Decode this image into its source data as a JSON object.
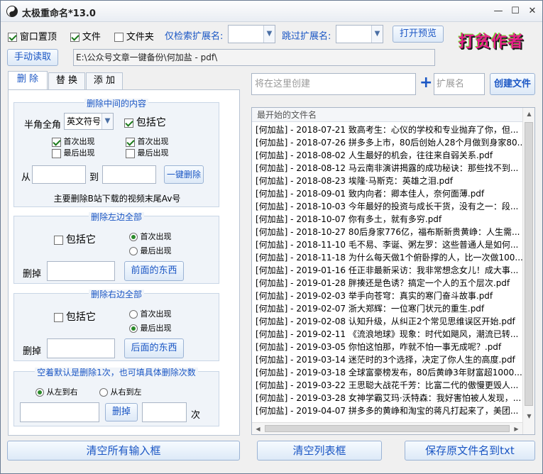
{
  "app": {
    "title": "太极重命名*13.0",
    "window_controls": {
      "minimize": "—",
      "maximize": "☐",
      "close": "✕"
    }
  },
  "top_bar": {
    "stay_on_top": {
      "label": "窗口置顶",
      "checked": true
    },
    "file": {
      "label": "文件",
      "checked": true
    },
    "folder": {
      "label": "文件夹",
      "checked": false
    },
    "only_ext_label": "仅检索扩展名:",
    "only_ext_value": "",
    "skip_ext_label": "跳过扩展名:",
    "skip_ext_value": "",
    "open_preview_button": "打开预览",
    "logo_text": "打贫作者",
    "manual_read_button": "手动读取",
    "path": "E:\\公众号文章一键备份\\何加盐 - pdf\\"
  },
  "tabs": [
    "删 除",
    "替 换",
    "添 加"
  ],
  "delete_middle": {
    "title": "删除中间的内容",
    "width_label": "半角全角",
    "width_value": "英文符号",
    "include_label": "包括它",
    "include_checked": true,
    "left_first": {
      "label": "首次出现",
      "checked": true
    },
    "left_last": {
      "label": "最后出现",
      "checked": false
    },
    "right_first": {
      "label": "首次出现",
      "checked": true
    },
    "right_last": {
      "label": "最后出现",
      "checked": false
    },
    "from_label": "从",
    "from_value": "",
    "to_label": "到",
    "to_value": "",
    "delete_button": "一键删除",
    "hint": "主要删除B站下载的视频末尾Av号"
  },
  "delete_left": {
    "title": "删除左边全部",
    "include_label": "包括它",
    "include_checked": false,
    "first": {
      "label": "首次出现",
      "checked": true
    },
    "last": {
      "label": "最后出现",
      "checked": false
    },
    "remove_label": "删掉",
    "remove_value": "",
    "button": "前面的东西"
  },
  "delete_right": {
    "title": "删除右边全部",
    "include_label": "包括它",
    "include_checked": false,
    "first": {
      "label": "首次出现",
      "checked": false
    },
    "last": {
      "label": "最后出现",
      "checked": true
    },
    "remove_label": "删掉",
    "remove_value": "",
    "button": "后面的东西"
  },
  "delete_count": {
    "title": "空着默认是删除1次，也可填具体删除次数",
    "left_to_right": {
      "label": "从左到右",
      "checked": true
    },
    "right_to_left": {
      "label": "从右到左",
      "checked": false
    },
    "text_value": "",
    "delete_button": "删掉",
    "count_value": "",
    "times_label": "次"
  },
  "create": {
    "placeholder": "将在这里创建",
    "plus": "+",
    "ext_placeholder": "扩展名",
    "button": "创建文件"
  },
  "file_list": {
    "header": "最开始的文件名",
    "rows": [
      "[何加盐] - 2018-07-21 致高考生：心仪的学校和专业抛弃了你，但...",
      "[何加盐] - 2018-07-26 拼多多上市，80后创始人28个月做到身家80...",
      "[何加盐] - 2018-08-02 人生最好的机会，往往来自弱关系.pdf",
      "[何加盐] - 2018-08-12 马云南非演讲揭露的成功秘诀：那些找不到...",
      "[何加盐] - 2018-08-23 埃隆·马斯克：英雄之泪.pdf",
      "[何加盐] - 2018-09-01 致内向者：卿本佳人，奈何面薄.pdf",
      "[何加盐] - 2018-10-03 今年最好的投资与成长干货，没有之一：段...",
      "[何加盐] - 2018-10-07 你有多土，就有多穷.pdf",
      "[何加盐] - 2018-10-27 80后身家776亿，福布斯新贵黄峥：人生需...",
      "[何加盐] - 2018-11-10 毛不易、李诞、粥左罗：这些普通人是如何...",
      "[何加盐] - 2018-11-18 为什么每天做1个俯卧撑的人，比一次做100...",
      "[何加盐] - 2019-01-16 任正非最新采访：我非常想念女儿！成大事...",
      "[何加盐] - 2019-01-28 胖揍还是色诱？搞定一个人的五个层次.pdf",
      "[何加盐] - 2019-02-03 举手向苍穹：真实的寒门奋斗故事.pdf",
      "[何加盐] - 2019-02-07 浙大郑辉：一位寒门状元的重生.pdf",
      "[何加盐] - 2019-02-08 认知升级，从纠正2个常见思维误区开始.pdf",
      "[何加盐] - 2019-02-11 《流浪地球》现象：时代如飓风，潮流已转...",
      "[何加盐] - 2019-03-05 你怕这怕那，咋就不怕一事无成呢？.pdf",
      "[何加盐] - 2019-03-14 迷茫时的3个选择，决定了你人生的高度.pdf",
      "[何加盐] - 2019-03-18 全球富豪榜发布，80后黄峥3年财富超1000...",
      "[何加盐] - 2019-03-22 王思聪大战花千芳：比富二代的傲慢更毁人...",
      "[何加盐] - 2019-03-28 女神学霸艾玛·沃特森：我好害怕被人发现，...",
      "[何加盐] - 2019-04-07 拼多多的黄峥和淘宝的蒋凡打起来了，美团..."
    ]
  },
  "bottom": {
    "clear_inputs": "清空所有输入框",
    "clear_list": "清空列表框",
    "save_names": "保存原文件名到txt"
  }
}
